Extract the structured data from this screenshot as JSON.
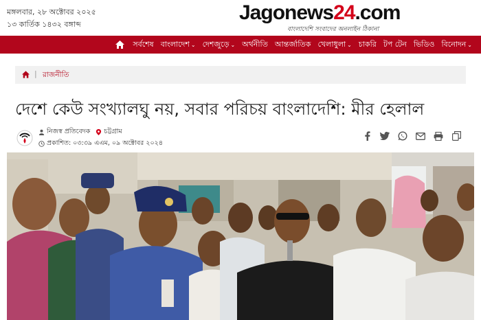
{
  "header": {
    "date_gregorian": "মঙ্গলবার, ২৮ অক্টোবর ২০২৫",
    "date_bangla": "১৩ কার্তিক ১৪৩২ বঙ্গাব্দ",
    "logo": {
      "part1": "Jago",
      "part2": "news",
      "part3": "24",
      "part4": ".com",
      "tagline": "বাংলাদেশি সংবাদের অনলাইন ঠিকানা"
    }
  },
  "nav": {
    "home_icon": "home-icon",
    "items": [
      {
        "label": "সর্বশেষ",
        "dropdown": false
      },
      {
        "label": "বাংলাদেশ",
        "dropdown": true
      },
      {
        "label": "দেশজুড়ে",
        "dropdown": true
      },
      {
        "label": "অর্থনীতি",
        "dropdown": false
      },
      {
        "label": "আন্তর্জাতিক",
        "dropdown": false
      },
      {
        "label": "খেলাধুলা",
        "dropdown": true
      },
      {
        "label": "চাকরি",
        "dropdown": false
      },
      {
        "label": "টপ টেন",
        "dropdown": false
      },
      {
        "label": "ভিডিও",
        "dropdown": false
      },
      {
        "label": "বিনোদন",
        "dropdown": true
      }
    ],
    "bg_color": "#b2061c"
  },
  "breadcrumb": {
    "category": "রাজনীতি"
  },
  "article": {
    "title": "দেশে কেউ সংখ্যালঘু নয়, সবার পরিচয় বাংলাদেশি: মীর হেলাল",
    "author": "নিজস্ব প্রতিবেদক",
    "location": "চট্টগ্রাম",
    "published_label": "প্রকাশিত: ০৩:৩৯ এএম, ০৯ অক্টোবর ২০২৪",
    "share_icons": [
      "facebook-icon",
      "twitter-icon",
      "whatsapp-icon",
      "email-icon",
      "print-icon",
      "copy-icon"
    ]
  }
}
